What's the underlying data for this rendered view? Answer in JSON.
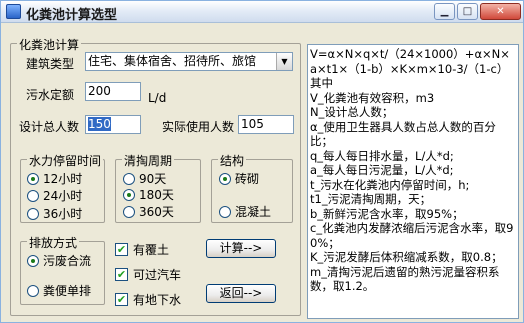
{
  "window": {
    "title": "化粪池计算选型",
    "buttons": {
      "minimize": "▁",
      "maximize": "□",
      "close": "✕"
    }
  },
  "main_group": {
    "title": "化粪池计算"
  },
  "building_type": {
    "label": "建筑类型",
    "selected": "住宅、集体宿舍、招待所、旅馆"
  },
  "sewage_quota": {
    "label": "污水定额",
    "value": "200",
    "unit": "L/d"
  },
  "design_population": {
    "label": "设计总人数",
    "value": "150"
  },
  "actual_users": {
    "label": "实际使用人数",
    "value": "105"
  },
  "retention_group": {
    "title": "水力停留时间",
    "options": [
      "12小时",
      "24小时",
      "36小时"
    ],
    "selected": 0
  },
  "cleaning_group": {
    "title": "清掏周期",
    "options": [
      "90天",
      "180天",
      "360天"
    ],
    "selected": 1
  },
  "structure_group": {
    "title": "结构",
    "options": [
      "砖砌",
      "混凝土"
    ],
    "selected": 0
  },
  "discharge_group": {
    "title": "排放方式",
    "options": [
      "污废合流",
      "粪便单排"
    ],
    "selected": 0
  },
  "checks": [
    {
      "label": "有覆土",
      "checked": true
    },
    {
      "label": "可过汽车",
      "checked": true
    },
    {
      "label": "有地下水",
      "checked": true
    }
  ],
  "buttons": {
    "calculate": "计算-->",
    "back": "返回-->"
  },
  "formula_text": [
    "V=α×N×q×t/（24×1000）+α×N×a×t1×（1-b）×K×m×10-3/（1-c） 其中",
    "V_化粪池有效容积，m3",
    "N_设计总人数；",
    "α_使用卫生器具人数占总人数的百分比；",
    "q_每人每日排水量，L/人*d;",
    "a_每人每日污泥量，L/人*d;",
    "t_污水在化粪池内停留时间，h;",
    "t1_污泥清掏周期，天；",
    "b_新鲜污泥含水率，取95%；",
    "c_化粪池内发酵浓缩后污泥含水率，取90%；",
    "K_污泥发酵后体积缩减系数，取0.8；",
    "m_清掏污泥后遗留的熟污泥量容积系数，取1.2。"
  ]
}
